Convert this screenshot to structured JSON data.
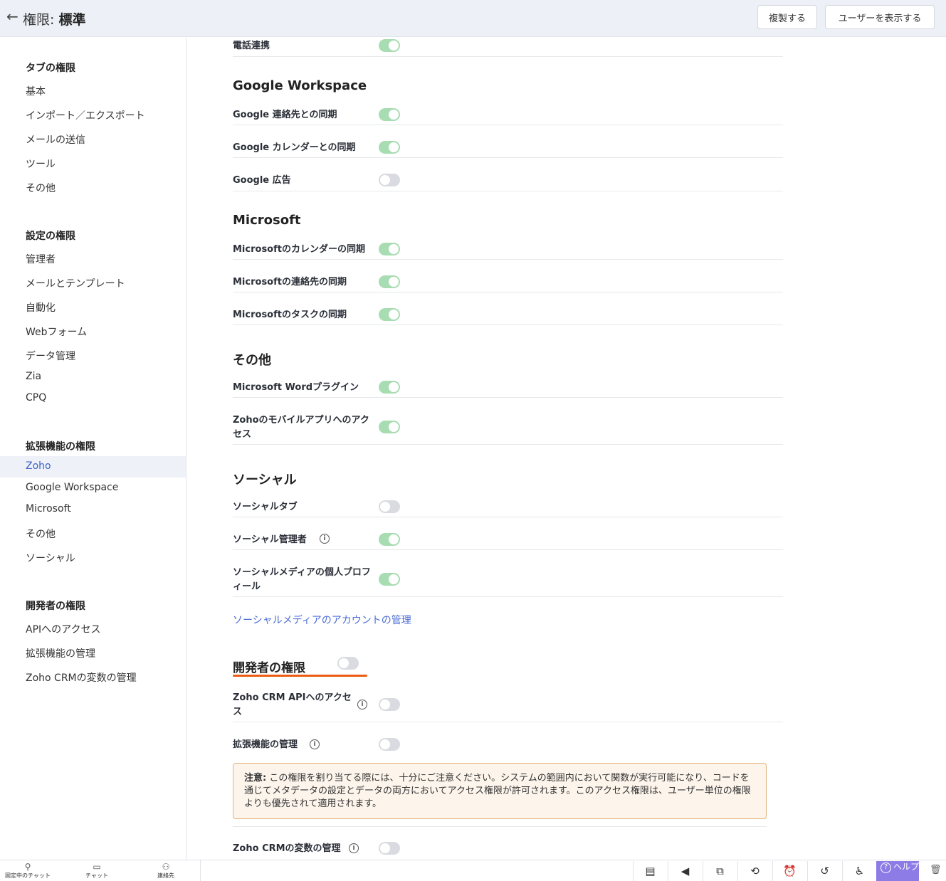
{
  "header": {
    "back_icon": "←",
    "title_prefix": "権限:",
    "title_name": "標準",
    "duplicate_label": "複製する",
    "show_users_label": "ユーザーを表示する"
  },
  "sidebar": {
    "tab_heading": "タブの権限",
    "tab_items": [
      "基本",
      "インポート／エクスポート",
      "メールの送信",
      "ツール",
      "その他"
    ],
    "settings_heading": "設定の権限",
    "settings_items": [
      "管理者",
      "メールとテンプレート",
      "自動化",
      "Webフォーム",
      "データ管理",
      "Zia",
      "CPQ"
    ],
    "extension_heading": "拡張機能の権限",
    "extension_items": [
      "Zoho",
      "Google Workspace",
      "Microsoft",
      "その他",
      "ソーシャル"
    ],
    "developer_heading": "開発者の権限",
    "developer_items": [
      "APIへのアクセス",
      "拡張機能の管理",
      "Zoho CRMの変数の管理"
    ]
  },
  "main": {
    "phone": {
      "label": "電話連携",
      "on": true
    },
    "google": {
      "heading": "Google Workspace",
      "rows": [
        {
          "label": "Google 連絡先との同期",
          "on": true
        },
        {
          "label": "Google カレンダーとの同期",
          "on": true
        },
        {
          "label": "Google 広告",
          "on": false
        }
      ]
    },
    "microsoft": {
      "heading": "Microsoft",
      "rows": [
        {
          "label": "Microsoftのカレンダーの同期",
          "on": true
        },
        {
          "label": "Microsoftの連絡先の同期",
          "on": true
        },
        {
          "label": "Microsoftのタスクの同期",
          "on": true
        }
      ]
    },
    "other": {
      "heading": "その他",
      "rows": [
        {
          "label": "Microsoft Wordプラグイン",
          "on": true
        },
        {
          "label": "Zohoのモバイルアプリへのアクセス",
          "on": true
        }
      ]
    },
    "social": {
      "heading": "ソーシャル",
      "rows": [
        {
          "label": "ソーシャルタブ",
          "on": false
        },
        {
          "label": "ソーシャル管理者",
          "on": true
        },
        {
          "label": "ソーシャルメディアの個人プロフィール",
          "on": true
        }
      ],
      "link": "ソーシャルメディアのアカウントの管理"
    },
    "developer": {
      "heading": "開発者の権限",
      "on": false,
      "rows": [
        {
          "label": "Zoho CRM APIへのアクセス",
          "on": false
        },
        {
          "label": "拡張機能の管理",
          "on": false
        },
        {
          "label": "Zoho CRMの変数の管理",
          "on": false
        }
      ],
      "note_prefix": "注意:",
      "note_text": "この権限を割り当てる際には、十分にご注意ください。システムの範囲内において関数が実行可能になり、コードを通じてメタデータの設定とデータの両方においてアクセス権限が許可されます。このアクセス権限は、ユーザー単位の権限よりも優先されて適用されます。"
    }
  },
  "bottom_bar": {
    "pinned_chat": "固定中のチャット",
    "chat": "チャット",
    "contacts": "連絡先",
    "help": "ヘルプ"
  }
}
